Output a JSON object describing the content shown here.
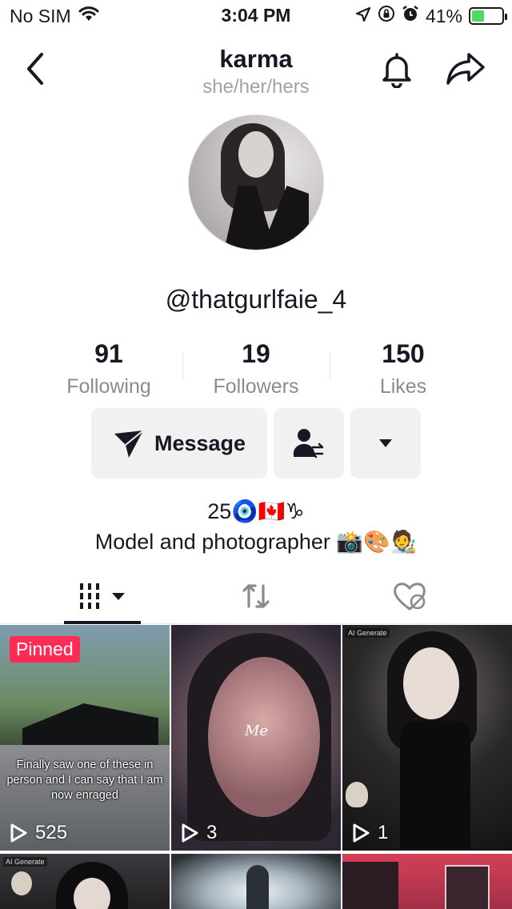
{
  "status_bar": {
    "carrier": "No SIM",
    "time": "3:04 PM",
    "battery": "41%",
    "battery_level": 0.41,
    "icons": [
      "wifi-icon",
      "location-icon",
      "orientation-lock-icon",
      "alarm-icon",
      "battery-charging-icon"
    ]
  },
  "header": {
    "title": "karma",
    "subtitle": "she/her/hers",
    "icons": [
      "back-icon",
      "bell-icon",
      "share-icon"
    ]
  },
  "profile": {
    "username": "@thatgurlfaie_4",
    "stats": [
      {
        "value": "91",
        "label": "Following"
      },
      {
        "value": "19",
        "label": "Followers"
      },
      {
        "value": "150",
        "label": "Likes"
      }
    ],
    "actions": {
      "message_label": "Message",
      "message_icon": "send-icon",
      "follow_icon": "user-swap-icon",
      "more_icon": "caret-down-icon"
    },
    "bio": {
      "line1": "25🧿🇨🇦♑",
      "line2": "Model and photographer 📸🎨🧑‍🎨"
    }
  },
  "tabs": [
    {
      "name": "videos",
      "icon": "grid-icon",
      "active": true
    },
    {
      "name": "reposts",
      "icon": "repost-icon",
      "active": false
    },
    {
      "name": "liked",
      "icon": "hidden-heart-icon",
      "active": false
    }
  ],
  "videos": [
    {
      "pinned_label": "Pinned",
      "caption": "Finally saw one of these in person and I can say that I am now enraged",
      "plays": "525"
    },
    {
      "plays": "3",
      "overlay_text": "Me"
    },
    {
      "plays": "1",
      "tag": "AI Generate"
    },
    {
      "tag": "AI Generate"
    },
    {},
    {}
  ],
  "colors": {
    "accent": "#fe2c55",
    "text": "#161823",
    "muted": "#8a8b91",
    "button_bg": "#f1f1f2"
  }
}
